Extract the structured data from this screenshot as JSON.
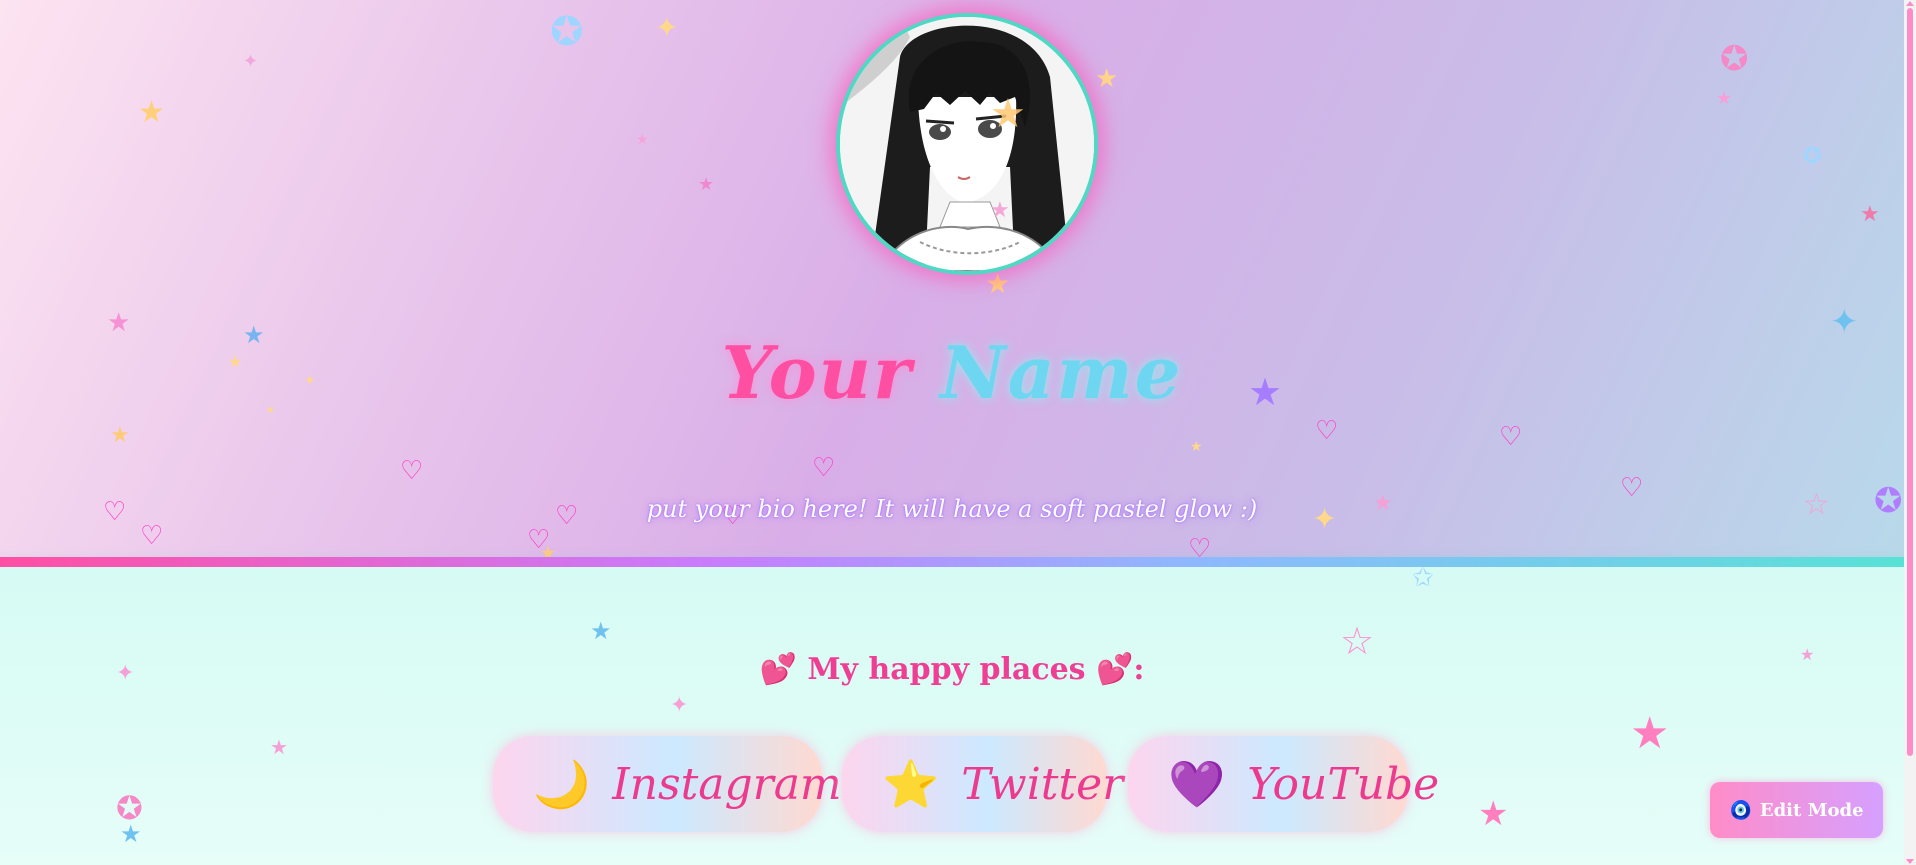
{
  "profile": {
    "title_part1": "Your",
    "title_part2": "Name",
    "bio": "put your bio here! It will have a soft pastel glow :)",
    "avatar_alt": "anime girl portrait"
  },
  "section": {
    "emoji_left": "💕",
    "title": "My happy places",
    "emoji_right": "💕",
    "suffix": ":"
  },
  "links": [
    {
      "emoji": "🌙",
      "label": "Instagram"
    },
    {
      "emoji": "⭐",
      "label": "Twitter"
    },
    {
      "emoji": "💜",
      "label": "YouTube"
    }
  ],
  "edit_button": {
    "icon": "🧿",
    "label": "Edit Mode"
  },
  "colors": {
    "accent_pink": "#ff4fa3",
    "accent_cyan": "#58e2d6",
    "accent_purple": "#c77dff"
  }
}
